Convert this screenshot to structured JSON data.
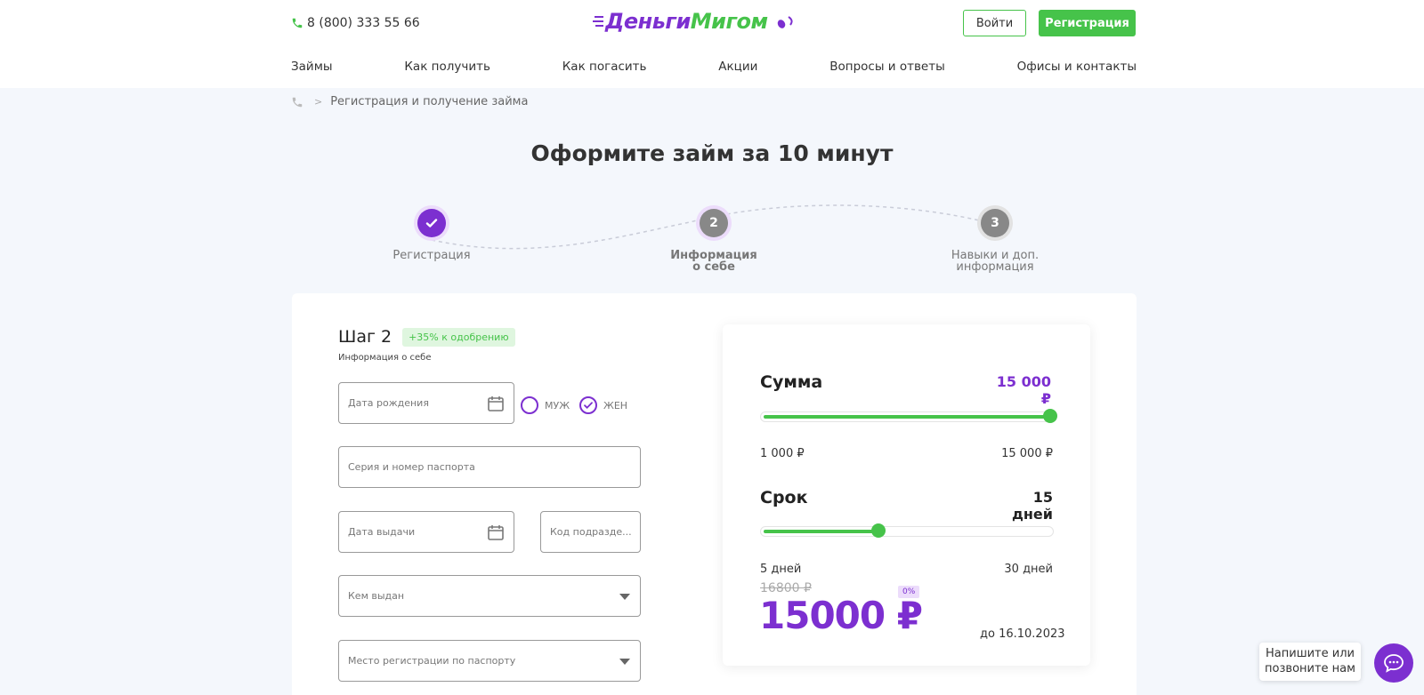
{
  "header": {
    "phone": "8 (800) 333 55 66",
    "logo_part1": "Деньги",
    "logo_part2": "Мигом",
    "login_label": "Войти",
    "register_label": "Регистрация"
  },
  "nav": {
    "items": [
      "Займы",
      "Как получить",
      "Как погасить",
      "Акции",
      "Вопросы и ответы",
      "Офисы и контакты"
    ]
  },
  "breadcrumb": {
    "separator": ">",
    "current": "Регистрация и получение займа"
  },
  "page_title": "Оформите займ за 10 минут",
  "steps": [
    {
      "number": "",
      "label": "Регистрация",
      "state": "done"
    },
    {
      "number": "2",
      "label": "Информация о себе",
      "state": "current"
    },
    {
      "number": "3",
      "label": "Навыки и доп. информация",
      "state": "upcoming"
    }
  ],
  "form": {
    "step_title": "Шаг 2",
    "approval_badge": "+35% к одобрению",
    "step_subtitle": "Информация о себе",
    "birth_date_placeholder": "Дата рождения",
    "gender_male": "МУЖ",
    "gender_female": "ЖЕН",
    "gender_selected": "ЖЕН",
    "passport_placeholder": "Серия и номер паспорта",
    "issue_date_placeholder": "Дата выдачи",
    "division_code_placeholder": "Код подразде...",
    "issued_by_placeholder": "Кем выдан",
    "registration_place_placeholder": "Место регистрации по паспорту"
  },
  "calculator": {
    "amount_label": "Сумма",
    "amount_value": "15 000 ₽",
    "amount_min": "1 000 ₽",
    "amount_max": "15 000 ₽",
    "amount_fraction": 1.0,
    "term_label": "Срок",
    "term_value": "15 дней",
    "term_min": "5 дней",
    "term_max": "30 дней",
    "term_fraction": 0.4,
    "old_price": "16800 ₽",
    "percent_badge": "0%",
    "total_price": "15000 ₽",
    "due_date": "до 16.10.2023"
  },
  "chat": {
    "line1": "Напишите или",
    "line2": "позвоните нам"
  },
  "colors": {
    "brand_purple": "#7c2fd0",
    "brand_green": "#46c34a",
    "page_bg": "#f4f7fc"
  }
}
